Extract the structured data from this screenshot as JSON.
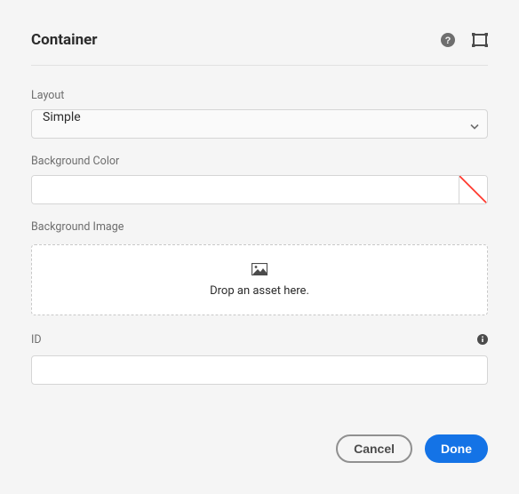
{
  "header": {
    "title": "Container"
  },
  "fields": {
    "layout": {
      "label": "Layout",
      "value": "Simple"
    },
    "backgroundColor": {
      "label": "Background Color",
      "value": ""
    },
    "backgroundImage": {
      "label": "Background Image",
      "dropText": "Drop an asset here."
    },
    "id": {
      "label": "ID",
      "value": ""
    }
  },
  "footer": {
    "cancel": "Cancel",
    "done": "Done"
  }
}
